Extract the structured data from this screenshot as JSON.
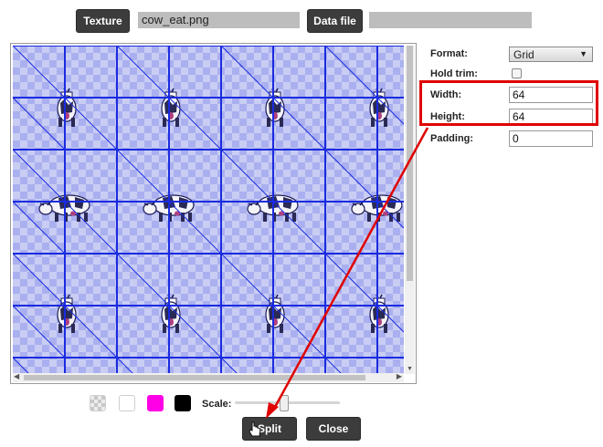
{
  "top_bar": {
    "texture_button": "Texture",
    "texture_filename": "cow_eat.png",
    "datafile_button": "Data file",
    "datafile_value": ""
  },
  "settings": {
    "format_label": "Format:",
    "format_value": "Grid",
    "hold_trim_label": "Hold trim:",
    "hold_trim_checked": false,
    "width_label": "Width:",
    "width_value": "64",
    "height_label": "Height:",
    "height_value": "64",
    "padding_label": "Padding:",
    "padding_value": "0"
  },
  "bottom_bar": {
    "scale_label": "Scale:",
    "scale_value": 0.45,
    "swatches": [
      {
        "name": "checker",
        "color": "#d9d9d9"
      },
      {
        "name": "white",
        "color": "#ffffff"
      },
      {
        "name": "magenta",
        "color": "#ff00e6"
      },
      {
        "name": "black",
        "color": "#000000"
      }
    ],
    "split_button": "Split",
    "close_button": "Close"
  },
  "annotation": {
    "highlight_color": "#e00000"
  }
}
